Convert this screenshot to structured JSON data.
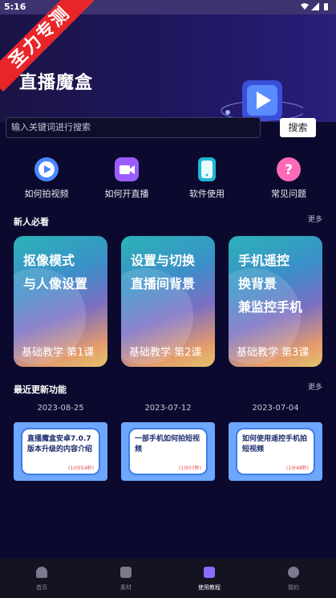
{
  "status_bar": {
    "time": "5:16"
  },
  "ribbon": {
    "text": "圣力专测"
  },
  "banner": {
    "title": "直播魔盒"
  },
  "search": {
    "placeholder": "输入关键词进行搜索",
    "button_label": "搜索"
  },
  "quick_links": [
    {
      "label": "如何拍视频",
      "icon": "play-icon",
      "color": "#4b86ff"
    },
    {
      "label": "如何开直播",
      "icon": "video-camera-icon",
      "color": "#9b5cff"
    },
    {
      "label": "软件使用",
      "icon": "phone-icon",
      "color": "#1fb7d6"
    },
    {
      "label": "常见问题",
      "icon": "question-icon",
      "color": "#ff6ab8"
    }
  ],
  "newbie": {
    "title": "新人必看",
    "more": "更多",
    "cards": [
      {
        "lines": [
          "抠像模式",
          "与人像设置"
        ],
        "footer": "基础教学 第1课"
      },
      {
        "lines": [
          "设置与切换",
          "直播间背景"
        ],
        "footer": "基础教学 第2课"
      },
      {
        "lines": [
          "手机遥控",
          "换背景",
          "兼监控手机"
        ],
        "footer": "基础教学 第3课"
      }
    ]
  },
  "updates": {
    "title": "最近更新功能",
    "more": "更多",
    "items": [
      {
        "date": "2023-08-25",
        "text": "直播魔盒安卓7.0.7版本升级的内容介绍",
        "duration": "(10分54秒)"
      },
      {
        "date": "2023-07-12",
        "text": "一部手机如何拍短视频",
        "duration": "(1分07秒)"
      },
      {
        "date": "2023-07-04",
        "text": "如何使用遥控手机拍短视频",
        "duration": "(1分48秒)"
      }
    ]
  },
  "nav": {
    "items": [
      {
        "label": "首页",
        "icon": "home-icon",
        "active": false
      },
      {
        "label": "素材",
        "icon": "box-icon",
        "active": false
      },
      {
        "label": "使用教程",
        "icon": "tutorial-icon",
        "active": true
      },
      {
        "label": "我的",
        "icon": "user-icon",
        "active": false
      }
    ]
  },
  "colors": {
    "background": "#0b0a2e",
    "accent": "#6da7ff",
    "ribbon": "#e8262a"
  }
}
